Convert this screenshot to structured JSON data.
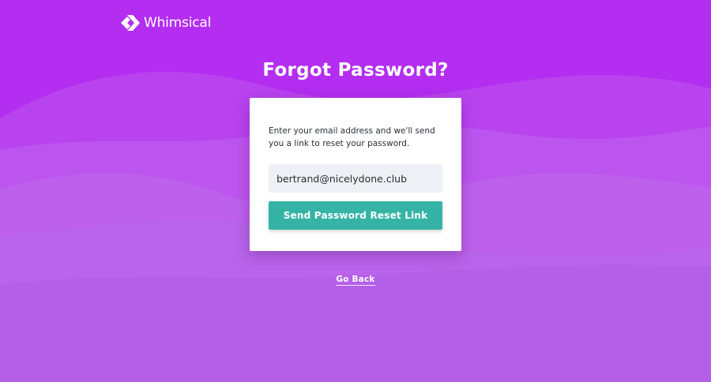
{
  "brand": {
    "name": "Whimsical",
    "logo_icon": "whimsical-logo-icon"
  },
  "page": {
    "title": "Forgot Password?"
  },
  "form": {
    "description": "Enter your email address and we'll send you a link to reset your password.",
    "email_value": "bertrand@nicelydone.club",
    "submit_label": "Send Password Reset Link"
  },
  "footer": {
    "go_back_label": "Go Back"
  },
  "colors": {
    "background": "#b32ef0",
    "button": "#35b4a6",
    "input_background": "#edf1f5",
    "card": "#ffffff"
  }
}
